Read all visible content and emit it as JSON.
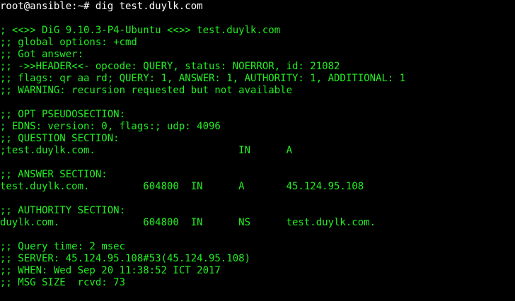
{
  "terminal": {
    "prompt": "root@ansible:~# dig test.duylk.com",
    "lines": [
      "",
      "; <<>> DiG 9.10.3-P4-Ubuntu <<>> test.duylk.com",
      ";; global options: +cmd",
      ";; Got answer:",
      ";; ->>HEADER<<- opcode: QUERY, status: NOERROR, id: 21082",
      ";; flags: qr aa rd; QUERY: 1, ANSWER: 1, AUTHORITY: 1, ADDITIONAL: 1",
      ";; WARNING: recursion requested but not available",
      "",
      ";; OPT PSEUDOSECTION:",
      "; EDNS: version: 0, flags:; udp: 4096",
      ";; QUESTION SECTION:",
      ";test.duylk.com.                        IN      A",
      "",
      ";; ANSWER SECTION:",
      "test.duylk.com.         604800  IN      A       45.124.95.108",
      "",
      ";; AUTHORITY SECTION:",
      "duylk.com.              604800  IN      NS      test.duylk.com.",
      "",
      ";; Query time: 2 msec",
      ";; SERVER: 45.124.95.108#53(45.124.95.108)",
      ";; WHEN: Wed Sep 20 11:38:52 ICT 2017",
      ";; MSG SIZE  rcvd: 73",
      ""
    ],
    "colors": {
      "background": "#000000",
      "output": "#22ee22",
      "prompt": "#ffffff"
    }
  }
}
